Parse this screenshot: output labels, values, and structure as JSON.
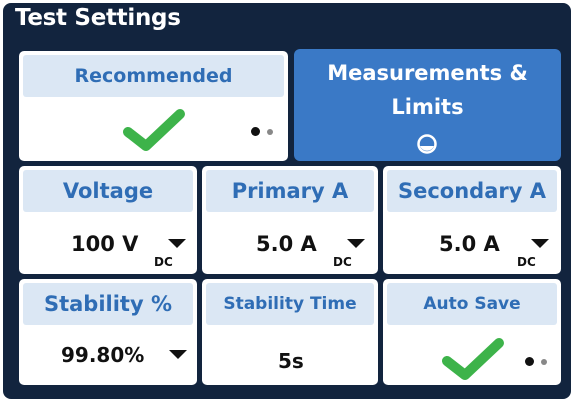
{
  "panel": {
    "title": "Test Settings"
  },
  "recommended": {
    "label": "Recommended",
    "checked": true,
    "page_dots": 2,
    "active_dot": 1
  },
  "measurements": {
    "line1": "Measurements &",
    "line2": "Limits",
    "icon": "spinner-icon"
  },
  "voltage": {
    "label": "Voltage",
    "value": "100 V",
    "unit": "DC"
  },
  "primary": {
    "label": "Primary A",
    "value": "5.0 A",
    "unit": "DC"
  },
  "secondary": {
    "label": "Secondary A",
    "value": "5.0 A",
    "unit": "DC"
  },
  "stability": {
    "label": "Stability %",
    "value": "99.80%"
  },
  "stability_time": {
    "label": "Stability Time",
    "value": "5s"
  },
  "auto_save": {
    "label": "Auto Save",
    "checked": true,
    "page_dots": 2,
    "active_dot": 1
  },
  "colors": {
    "panel_bg": "#12243e",
    "header_bg": "#dbe7f4",
    "header_text": "#2f6db5",
    "accent_blue": "#3a79c6",
    "check_green": "#3db34a"
  }
}
